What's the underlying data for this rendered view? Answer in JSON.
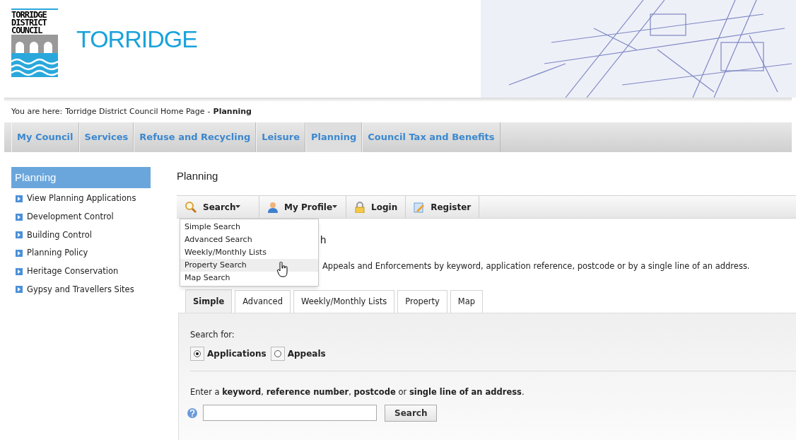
{
  "header": {
    "logo_lines": [
      "TORRIDGE",
      "DISTRICT",
      "COUNCIL"
    ],
    "site_title": "TORRIDGE"
  },
  "breadcrumb": {
    "prefix": "You are here:",
    "link": "Torridge District Council Home Page",
    "separator": "-",
    "current": "Planning"
  },
  "nav": [
    {
      "label": "My Council",
      "selected": false
    },
    {
      "label": "Services",
      "selected": false
    },
    {
      "label": "Refuse and Recycling",
      "selected": false
    },
    {
      "label": "Leisure",
      "selected": false
    },
    {
      "label": "Planning",
      "selected": true
    },
    {
      "label": "Council Tax and Benefits",
      "selected": false
    }
  ],
  "sidebar": {
    "title": "Planning",
    "items": [
      "View Planning Applications",
      "Development Control",
      "Building Control",
      "Planning Policy",
      "Heritage Conservation",
      "Gypsy and Travellers Sites"
    ]
  },
  "page_title": "Planning",
  "toolbar": [
    {
      "label": "Search",
      "kind": "search",
      "dropdown": true
    },
    {
      "label": "My Profile",
      "kind": "profile",
      "dropdown": true
    },
    {
      "label": "Login",
      "kind": "login",
      "dropdown": false
    },
    {
      "label": "Register",
      "kind": "register",
      "dropdown": false
    }
  ],
  "search_menu": [
    {
      "label": "Simple Search",
      "selected": false
    },
    {
      "label": "Advanced Search",
      "selected": false
    },
    {
      "label": "Weekly/Monthly Lists",
      "selected": false
    },
    {
      "label": "Property Search",
      "selected": true
    },
    {
      "label": "Map Search",
      "selected": false
    }
  ],
  "section_heading_visible": "h",
  "description_visible": "Appeals and Enforcements by keyword, application reference, postcode or by a single line of an address.",
  "tabs": [
    {
      "label": "Simple",
      "selected": true
    },
    {
      "label": "Advanced",
      "selected": false
    },
    {
      "label": "Weekly/Monthly Lists",
      "selected": false
    },
    {
      "label": "Property",
      "selected": false
    },
    {
      "label": "Map",
      "selected": false
    }
  ],
  "form": {
    "search_for_label": "Search for:",
    "options": [
      {
        "label": "Applications",
        "checked": true
      },
      {
        "label": "Appeals",
        "checked": false
      }
    ],
    "instruction": "Enter a **keyword**, **reference number**, **postcode** or **single line of an address**.",
    "search_button": "Search"
  }
}
